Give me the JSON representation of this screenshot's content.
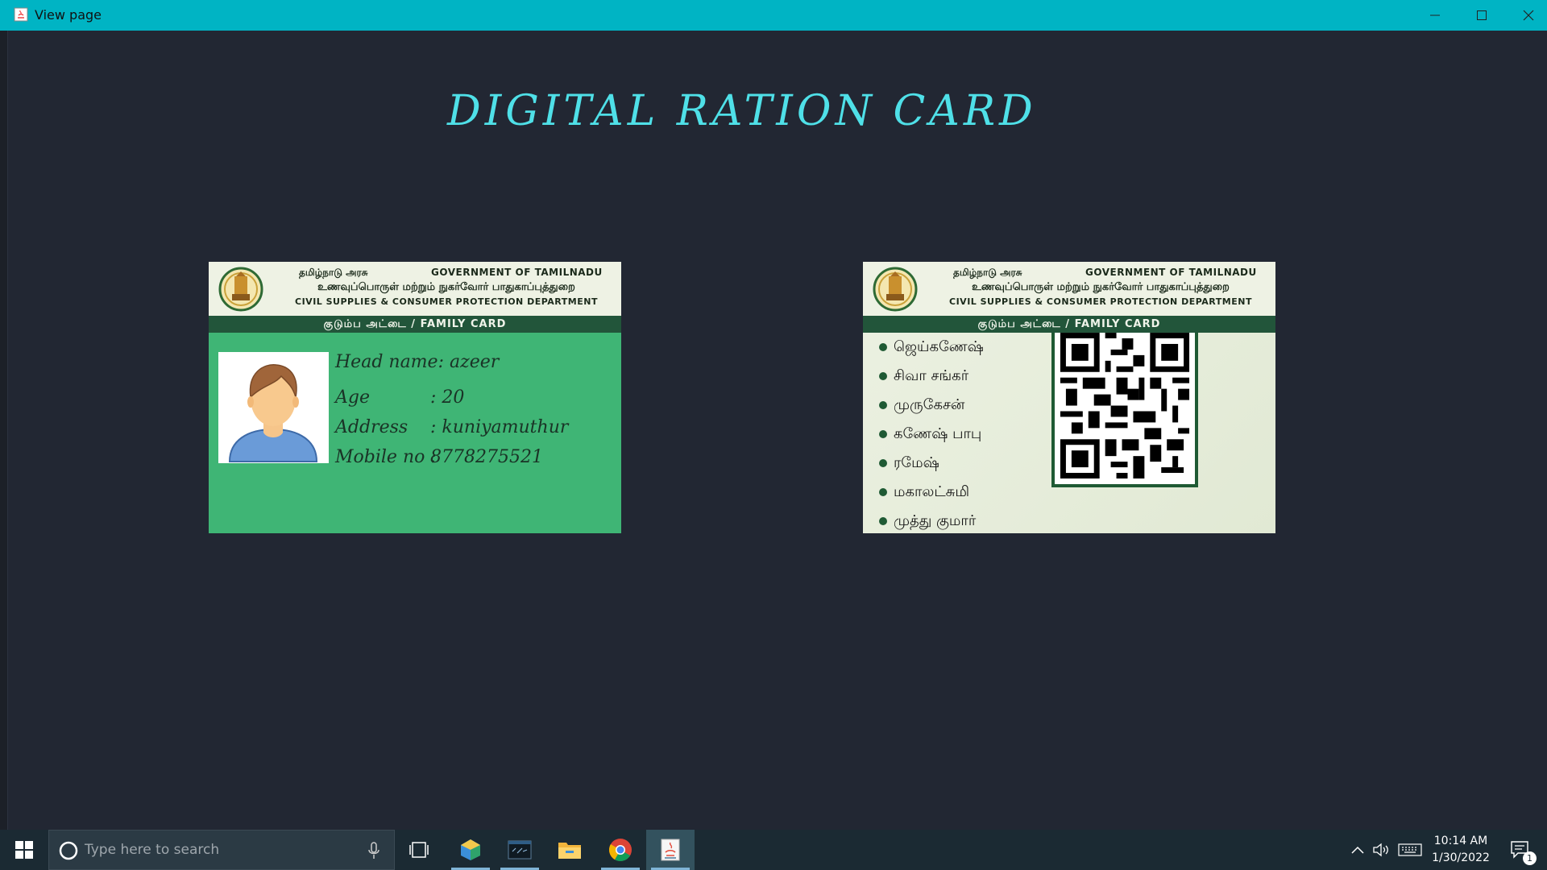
{
  "window": {
    "title": "View page",
    "titlebar_color": "#00b4c4"
  },
  "page": {
    "heading": "DIGITAL RATION CARD",
    "background": "#222733",
    "heading_color": "#4fe0e8"
  },
  "card_header": {
    "gov_tamil": "தமிழ்நாடு அரசு",
    "gov_english": "GOVERNMENT OF TAMILNADU",
    "dept_tamil": "உணவுப்பொருள் மற்றும் நுகர்வோர் பாதுகாப்புத்துறை",
    "dept_english": "CIVIL SUPPLIES & CONSUMER PROTECTION DEPARTMENT",
    "band": "குடும்ப அட்டை / FAMILY CARD"
  },
  "front_card": {
    "color": "#3fb575",
    "fields": [
      {
        "label": "Head name:",
        "value": "azeer"
      },
      {
        "label": "Age",
        "value": ": 20"
      },
      {
        "label": "Address",
        "value": ": kuniyamuthur"
      },
      {
        "label": "Mobile no :",
        "value": "8778275521"
      }
    ]
  },
  "back_card": {
    "members": [
      "ஜெய்கணேஷ்",
      "சிவா சங்கர்",
      "முருகேசன்",
      "கணேஷ் பாபு",
      "ரமேஷ்",
      "மகாலட்சுமி",
      "முத்து குமார்"
    ]
  },
  "taskbar": {
    "search_placeholder": "Type here to search",
    "time": "10:14 AM",
    "date": "1/30/2022",
    "notification_count": "1",
    "apps": [
      "cube-app-icon",
      "mysql-icon",
      "file-explorer-icon",
      "chrome-icon",
      "java-icon"
    ]
  }
}
